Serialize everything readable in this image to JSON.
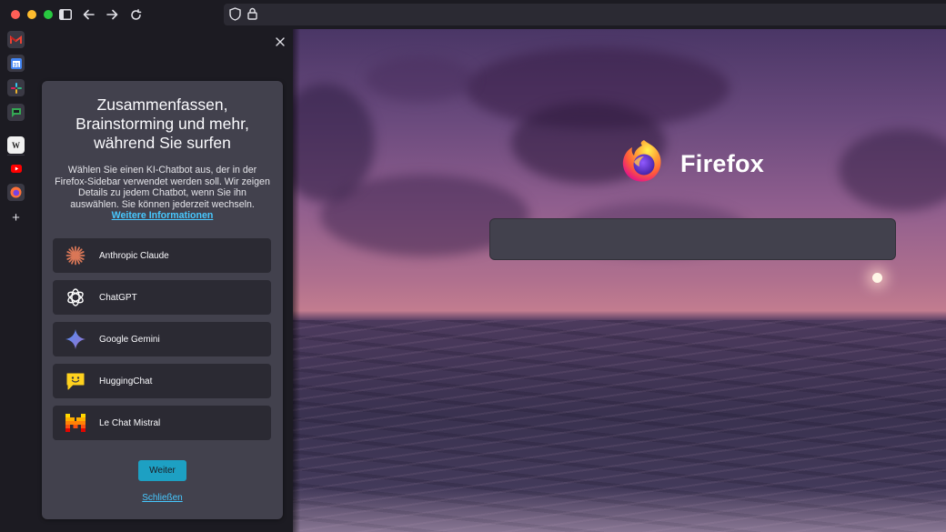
{
  "sidebar": {
    "heading": "Zusammenfassen, Brainstorming und mehr, während Sie surfen",
    "description": "Wählen Sie einen KI-Chatbot aus, der in der Firefox-Sidebar verwendet werden soll. Wir zeigen Details zu jedem Chatbot, wenn Sie ihn auswählen. Sie können jederzeit wechseln.",
    "learn_more": "Weitere Informationen",
    "chatbots": [
      {
        "name": "Anthropic Claude",
        "icon": "claude-icon"
      },
      {
        "name": "ChatGPT",
        "icon": "chatgpt-icon"
      },
      {
        "name": "Google Gemini",
        "icon": "gemini-icon"
      },
      {
        "name": "HuggingChat",
        "icon": "huggingchat-icon"
      },
      {
        "name": "Le Chat Mistral",
        "icon": "mistral-icon"
      }
    ],
    "continue_label": "Weiter",
    "close_label": "Schließen"
  },
  "rail": {
    "wikipedia_glyph": "W"
  },
  "newtab": {
    "brand_name": "Firefox",
    "search_placeholder": ""
  },
  "colors": {
    "accent": "#1da0c3",
    "link": "#47c8ff",
    "card_bg": "#42414d",
    "panel_bg": "#1c1b22"
  }
}
